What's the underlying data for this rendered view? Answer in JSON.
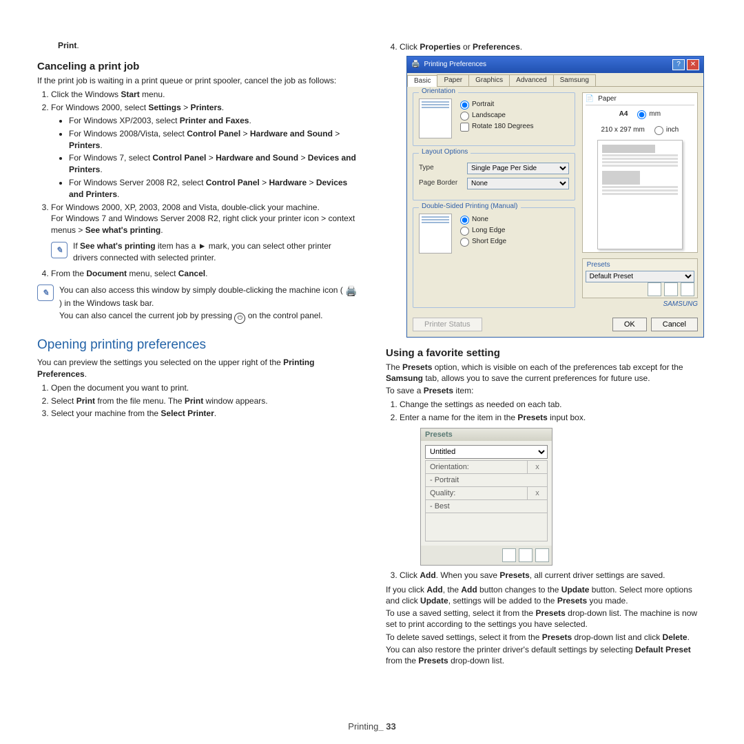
{
  "left": {
    "print": "Print",
    "h_cancel": "Canceling a print job",
    "cancel_intro": "If the print job is waiting in a print queue or print spooler, cancel the job as follows:",
    "s1": "Click the Windows ",
    "s1b": "Start",
    " s1c": " menu.",
    "s2a": "For Windows 2000, select ",
    "s2b": "Settings",
    "s2c": " > ",
    "s2d": "Printers",
    "s2e": ".",
    "bxp": "For Windows XP/2003, select ",
    "bxpb": "Printer and Faxes",
    "bxpend": ".",
    "bvista": "For Windows 2008/Vista, select ",
    "bv1": "Control Panel",
    "bv2": " > ",
    "bv3": "Hardware and Sound",
    "bv4": " > ",
    "bv5": "Printers",
    "bvend": ".",
    "b7": "For Windows 7, select ",
    "b71": "Control Panel",
    "b72": " > ",
    "b73": "Hardware and Sound",
    "b74": " > ",
    "b75": "Devices and Printers",
    "b7end": ".",
    "b8": "For Windows Server 2008 R2, select ",
    "b81": "Control Panel",
    "b82": " > ",
    "b83": "Hardware",
    "b84": " > ",
    "b85": "Devices and Printers",
    "b8end": ".",
    "s3a": "For Windows 2000, XP, 2003, 2008 and Vista, double-click your machine.",
    "s3b": "For Windows 7 and Windows Server 2008 R2, right click your printer icon > context menus > ",
    "s3c": "See what's printing",
    "s3d": ".",
    "note1a": "If ",
    "note1b": "See what's printing",
    "note1c": " item has a ► mark, you can select other printer drivers connected with selected printer.",
    "s4a": "From the ",
    "s4b": "Document",
    "s4c": " menu, select ",
    "s4d": "Cancel",
    "s4e": ".",
    "note2a": "You can also access this window by simply double-clicking the machine icon ( ",
    "note2b": " ) in the Windows task bar.",
    "note2c": "You can also cancel the current job by pressing ",
    "note2d": " on the control panel.",
    "h_open": "Opening printing preferences",
    "open_intro_a": "You can preview the settings you selected on the upper right of the ",
    "open_intro_b": "Printing Preferences",
    "open_intro_c": ".",
    "o1": "Open the document you want to print.",
    "o2a": "Select ",
    "o2b": "Print",
    "o2c": " from the file menu. The ",
    "o2d": "Print",
    "o2e": " window appears.",
    "o3a": "Select your machine from the ",
    "o3b": "Select Printer",
    "o3c": "."
  },
  "right": {
    "s4a": "Click ",
    "s4b": "Properties",
    "s4c": " or ",
    "s4d": "Preferences",
    "s4e": ".",
    "dlg": {
      "title": "Printing Preferences",
      "tabs": [
        "Basic",
        "Paper",
        "Graphics",
        "Advanced",
        "Samsung"
      ],
      "orientation": "Orientation",
      "portrait": "Portrait",
      "landscape": "Landscape",
      "rotate": "Rotate 180 Degrees",
      "layout": "Layout Options",
      "type": "Type",
      "type_v": "Single Page Per Side",
      "border": "Page Border",
      "border_v": "None",
      "dsp": "Double-Sided Printing (Manual)",
      "none": "None",
      "long": "Long Edge",
      "short": "Short Edge",
      "paper": "Paper",
      "a4": "A4",
      "dim": "210 x 297 mm",
      "mm": "mm",
      "inch": "inch",
      "presets": "Presets",
      "preset_v": "Default Preset",
      "printer_status": "Printer Status",
      "ok": "OK",
      "cancel": "Cancel",
      "logo": "SAMSUNG"
    },
    "h_fav": "Using a favorite setting",
    "fav_intro": "The Presets option, which is visible on each of the preferences tab except for the Samsung tab, allows you to save the current preferences for future use.",
    "fav_save": "To save a Presets item:",
    "f1": "Change the settings as needed on each tab.",
    "f2a": "Enter a name for the item in the ",
    "f2b": "Presets",
    "f2c": " input box.",
    "mini": {
      "title": "Presets",
      "value": "Untitled",
      "r1": "Orientation:",
      "r1v": "- Portrait",
      "r2": "Quality:",
      "r2v": "- Best"
    },
    "f3a": "Click ",
    "f3b": "Add",
    "f3c": ". When you save ",
    "f3d": "Presets",
    "f3e": ", all current driver settings are saved.",
    "p1": "If you click Add, the Add button changes to the Update button. Select more options and click Update, settings will be added to the Presets you made.",
    "p2": "To use a saved setting, select it from the Presets drop-down list. The machine is now set to print according to the settings you have selected.",
    "p3a": "To delete saved settings, select it from the ",
    "p3b": "Presets",
    "p3c": " drop-down list and click ",
    "p3d": "Delete",
    "p3e": ".",
    "p4a": "You can also restore the printer driver's default settings by selecting ",
    "p4b": "Default Preset",
    "p4c": " from the ",
    "p4d": "Presets",
    "p4e": " drop-down list."
  },
  "footer": {
    "a": "Printing",
    "b": "_ 33"
  }
}
